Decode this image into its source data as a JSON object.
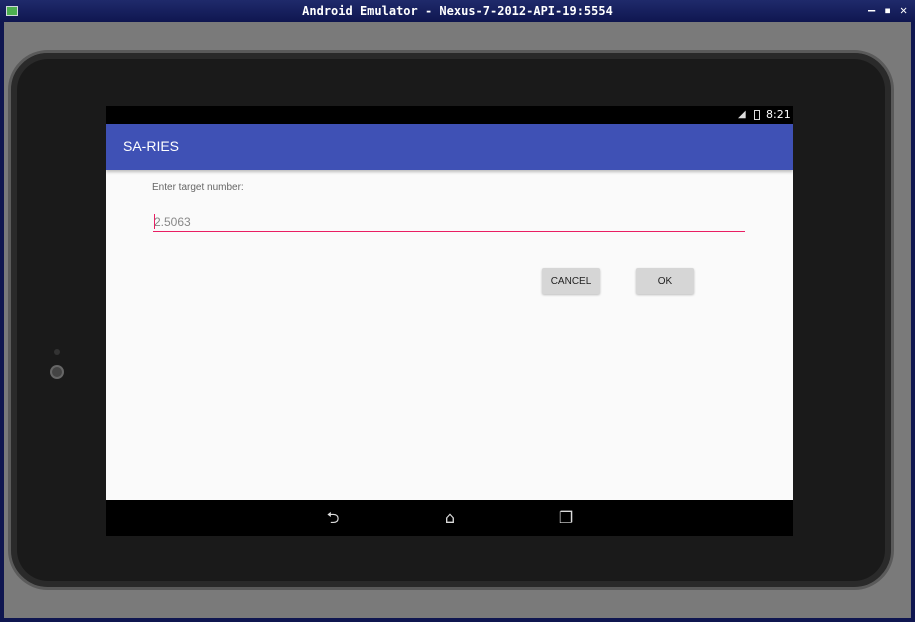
{
  "window": {
    "title": "Android Emulator - Nexus-7-2012-API-19:5554",
    "controls": {
      "minimize": "‒",
      "maximize": "▪",
      "close": "✕"
    }
  },
  "device": {
    "status_bar": {
      "time": "8:21",
      "signal_icon": "signal-icon",
      "battery_icon": "battery-icon",
      "signal_glyph": "◢"
    },
    "app_bar": {
      "title": "SA-RIES"
    },
    "form": {
      "prompt": "Enter target number:",
      "input_value": "2.5063",
      "cancel_label": "CANCEL",
      "ok_label": "OK"
    },
    "nav_bar": {
      "back_glyph": "⮌",
      "home_glyph": "⌂",
      "recent_glyph": "❐"
    }
  },
  "colors": {
    "app_bar": "#3f51b5",
    "accent": "#e91e63",
    "window_title_bar": "#1a237e"
  }
}
